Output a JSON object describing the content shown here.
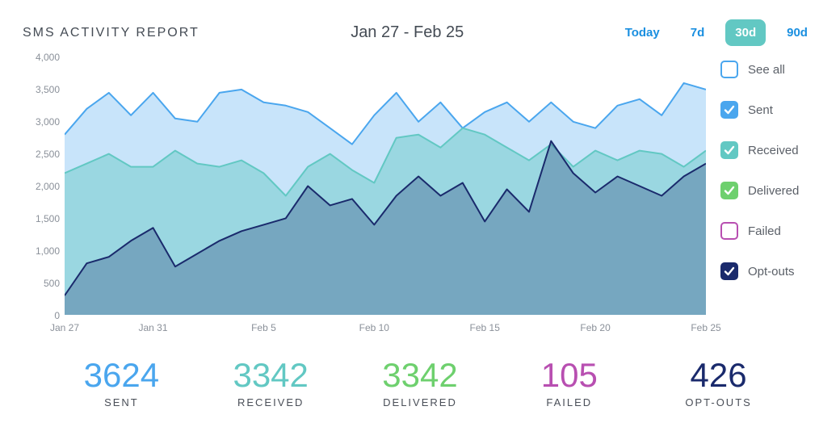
{
  "header": {
    "title": "SMS ACTIVITY REPORT",
    "date_range": "Jan 27 - Feb 25",
    "range_options": [
      "Today",
      "7d",
      "30d",
      "90d"
    ],
    "active_range_index": 2
  },
  "legend": [
    {
      "label": "See all",
      "color": "#4aa6ee",
      "checked": false,
      "style": "outline"
    },
    {
      "label": "Sent",
      "color": "#4aa6ee",
      "checked": true,
      "style": "solid"
    },
    {
      "label": "Received",
      "color": "#62c8c3",
      "checked": true,
      "style": "solid"
    },
    {
      "label": "Delivered",
      "color": "#6ed06e",
      "checked": true,
      "style": "solid"
    },
    {
      "label": "Failed",
      "color": "#b84fb1",
      "checked": false,
      "style": "outline"
    },
    {
      "label": "Opt-outs",
      "color": "#1a2a6c",
      "checked": true,
      "style": "solid"
    }
  ],
  "stats": [
    {
      "label": "SENT",
      "value": "3624",
      "color": "#4aa6ee"
    },
    {
      "label": "RECEIVED",
      "value": "3342",
      "color": "#62c8c3"
    },
    {
      "label": "DELIVERED",
      "value": "3342",
      "color": "#6ed06e"
    },
    {
      "label": "FAILED",
      "value": "105",
      "color": "#b84fb1"
    },
    {
      "label": "OPT-OUTS",
      "value": "426",
      "color": "#1a2a6c"
    }
  ],
  "chart_data": {
    "type": "area",
    "title": "SMS ACTIVITY REPORT",
    "xlabel": "",
    "ylabel": "",
    "ylim": [
      0,
      4000
    ],
    "y_ticks": [
      0,
      500,
      1000,
      1500,
      2000,
      2500,
      3000,
      3500,
      4000
    ],
    "x_ticks": [
      {
        "label": "Jan 27",
        "index": 0
      },
      {
        "label": "Jan 31",
        "index": 4
      },
      {
        "label": "Feb 5",
        "index": 9
      },
      {
        "label": "Feb 10",
        "index": 14
      },
      {
        "label": "Feb 15",
        "index": 19
      },
      {
        "label": "Feb 20",
        "index": 24
      },
      {
        "label": "Feb 25",
        "index": 29
      }
    ],
    "categories": [
      "Jan 27",
      "Jan 28",
      "Jan 29",
      "Jan 30",
      "Jan 31",
      "Feb 1",
      "Feb 2",
      "Feb 3",
      "Feb 4",
      "Feb 5",
      "Feb 6",
      "Feb 7",
      "Feb 8",
      "Feb 9",
      "Feb 10",
      "Feb 11",
      "Feb 12",
      "Feb 13",
      "Feb 14",
      "Feb 15",
      "Feb 16",
      "Feb 17",
      "Feb 18",
      "Feb 19",
      "Feb 20",
      "Feb 21",
      "Feb 22",
      "Feb 23",
      "Feb 24",
      "Feb 25"
    ],
    "series": [
      {
        "name": "Sent",
        "color": "#4aa6ee",
        "fill": "rgba(74,166,238,0.30)",
        "values": [
          2800,
          3200,
          3450,
          3100,
          3450,
          3050,
          3000,
          3450,
          3500,
          3300,
          3250,
          3150,
          2900,
          2650,
          3100,
          3450,
          3000,
          3300,
          2900,
          3150,
          3300,
          3000,
          3300,
          3000,
          2900,
          3250,
          3350,
          3100,
          3600,
          3500
        ]
      },
      {
        "name": "Received",
        "color": "#62c8c3",
        "fill": "rgba(98,200,195,0.45)",
        "values": [
          2200,
          2350,
          2500,
          2300,
          2300,
          2550,
          2350,
          2300,
          2400,
          2200,
          1850,
          2300,
          2500,
          2250,
          2050,
          2750,
          2800,
          2600,
          2900,
          2800,
          2600,
          2400,
          2650,
          2300,
          2550,
          2400,
          2550,
          2500,
          2300,
          2550
        ]
      },
      {
        "name": "Opt-outs",
        "color": "#1a2a6c",
        "fill": "rgba(26,42,108,0.28)",
        "values": [
          300,
          800,
          900,
          1150,
          1350,
          750,
          950,
          1150,
          1300,
          1400,
          1500,
          2000,
          1700,
          1800,
          1400,
          1850,
          2150,
          1850,
          2050,
          1450,
          1950,
          1600,
          2700,
          2200,
          1900,
          2150,
          2000,
          1850,
          2150,
          2350
        ]
      }
    ]
  }
}
